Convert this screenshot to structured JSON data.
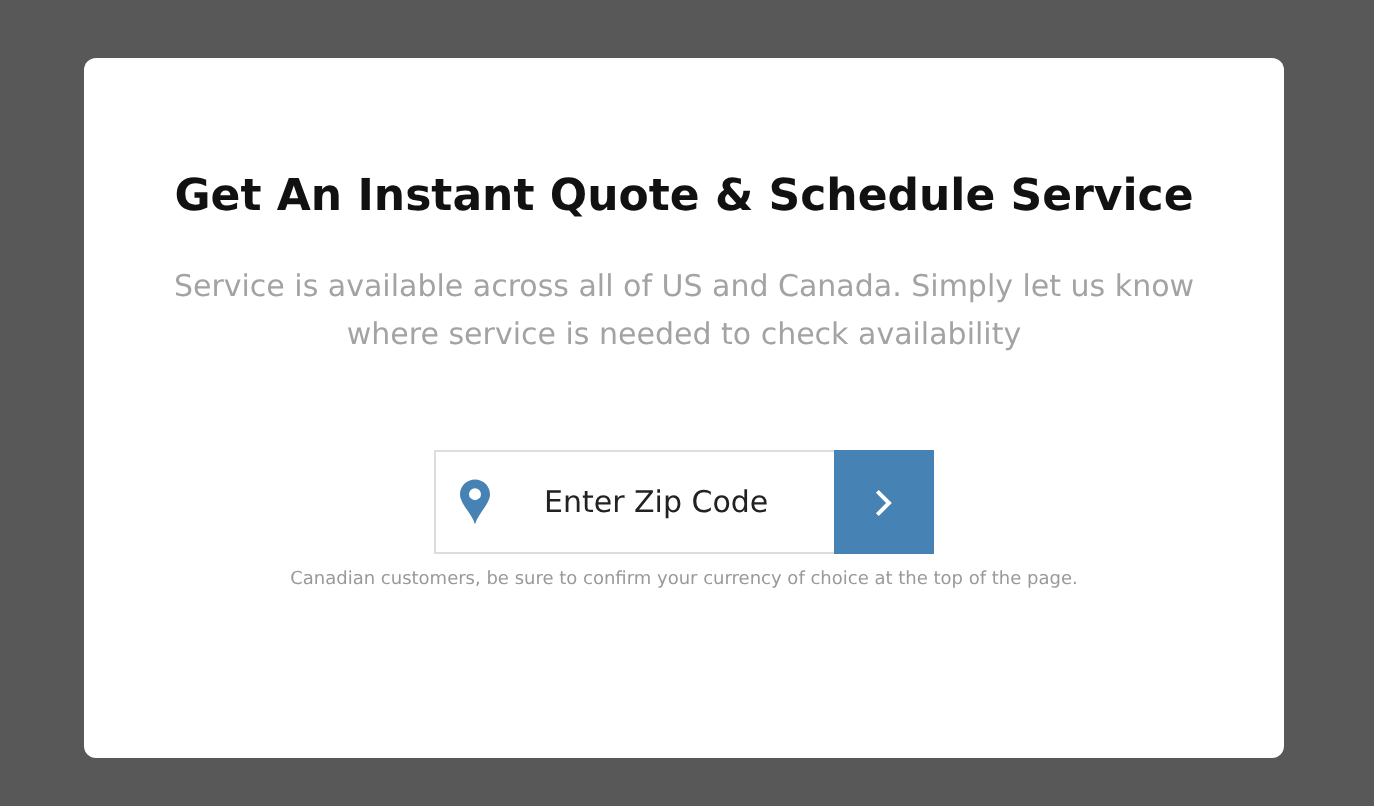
{
  "modal": {
    "title": "Get An Instant Quote & Schedule Service",
    "description": "Service is available across all of US and Canada. Simply let us know where service is needed to check availability",
    "zip_field": {
      "placeholder": "Enter Zip Code"
    },
    "note": "Canadian customers, be sure to confirm your currency of choice at the top of the page."
  }
}
